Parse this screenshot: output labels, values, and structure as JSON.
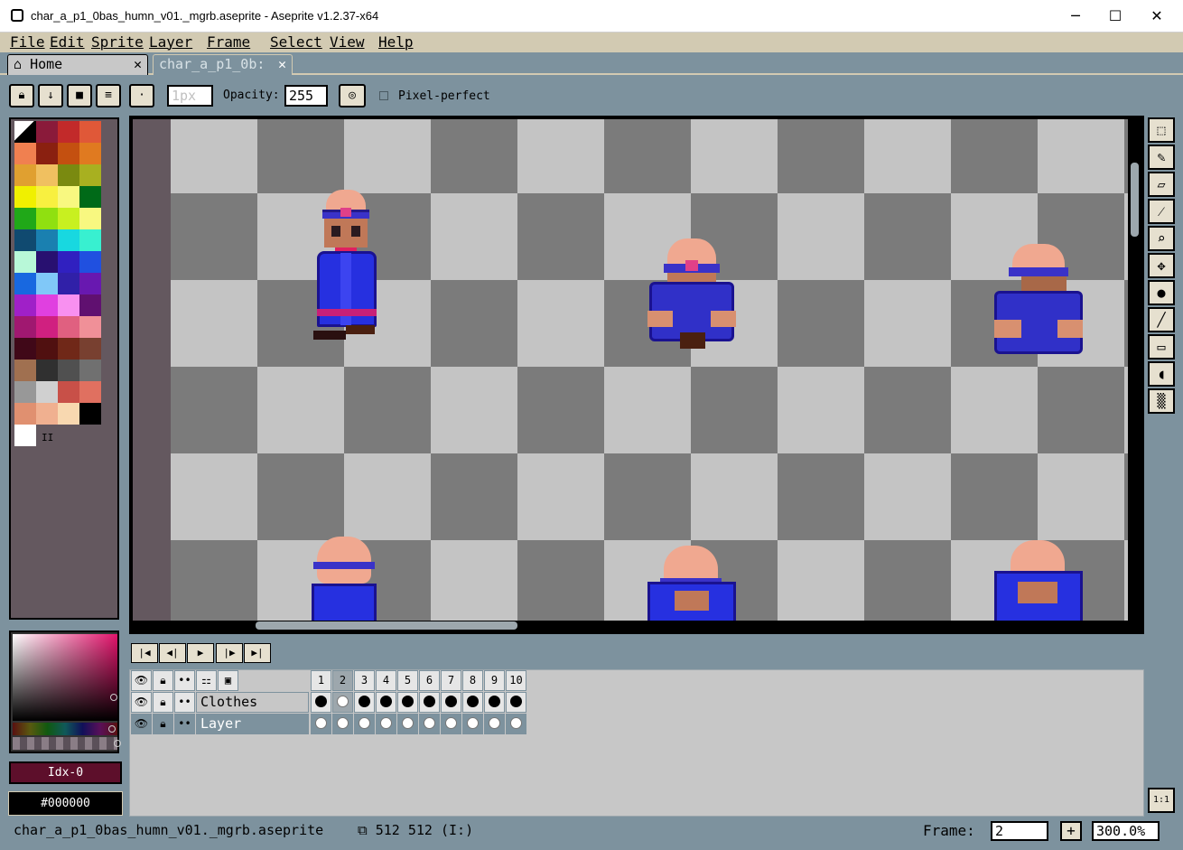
{
  "window": {
    "title": "char_a_p1_0bas_humn_v01._mgrb.aseprite - Aseprite v1.2.37-x64",
    "minimize": "─",
    "maximize": "☐",
    "close": "✕"
  },
  "menu": [
    "File",
    "Edit",
    "Sprite",
    "Layer",
    "Frame",
    "Select",
    "View",
    "Help"
  ],
  "tabs": [
    {
      "label": "Home",
      "icon": "home-icon",
      "close": "✕"
    },
    {
      "label": "char_a_p1_0b:",
      "close": "✕"
    }
  ],
  "context_bar": {
    "brush_size_placeholder": "1px",
    "opacity_label": "Opacity:",
    "opacity_value": "255",
    "pixel_perfect_label": "Pixel-perfect"
  },
  "palette": {
    "colors": [
      "#000000",
      "#8a1a3a",
      "#c22a2a",
      "#e05838",
      "#f08050",
      "#8a2010",
      "#c45010",
      "#e07a20",
      "#e0a030",
      "#f0c060",
      "#7a8a10",
      "#a8b020",
      "#f0f000",
      "#f8f040",
      "#f8f880",
      "#006a18",
      "#20a818",
      "#90e010",
      "#c8f020",
      "#f8f880",
      "#104a70",
      "#1a80b0",
      "#18d8e0",
      "#38f0d0",
      "#b8f8d8",
      "#281070",
      "#3020c0",
      "#2050e0",
      "#1868e0",
      "#80c8f8",
      "#3020a8",
      "#6818b0",
      "#a020c8",
      "#e040e0",
      "#f890f0",
      "#601070",
      "#a01870",
      "#d02080",
      "#e06080",
      "#f09098",
      "#400818",
      "#501010",
      "#702818",
      "#784030",
      "#a07050",
      "#303030",
      "#505050",
      "#707070",
      "#989898",
      "#d0d0d0",
      "#c85048",
      "#e07060",
      "#e09070",
      "#f0b090",
      "#f8d8b0",
      "#000000",
      "#ffffff"
    ],
    "mini_label": "II"
  },
  "color_boxes": {
    "foreground": "Idx-0",
    "background": "#000000"
  },
  "timeline": {
    "frames": [
      "1",
      "2",
      "3",
      "4",
      "5",
      "6",
      "7",
      "8",
      "9",
      "10"
    ],
    "active_frame_index": 1,
    "layers": [
      {
        "name": "Clothes",
        "cel_style": "filled"
      },
      {
        "name": "Layer",
        "cel_style": "empty"
      }
    ]
  },
  "status": {
    "filename": "char_a_p1_0bas_humn_v01._mgrb.aseprite",
    "dimensions": "512 512",
    "extra": "(I:)",
    "frame_label": "Frame:",
    "frame_value": "2",
    "zoom": "300.0%"
  },
  "tools": [
    "marquee-icon",
    "pencil-icon",
    "eraser-icon",
    "eyedropper-icon",
    "zoom-icon",
    "move-icon",
    "paint-bucket-icon",
    "line-icon",
    "rectangle-icon",
    "contour-icon",
    "blur-icon"
  ],
  "ratio_button": "1:1",
  "colors": {
    "menu_bg": "#d2cab2",
    "workspace_bg": "#7d929e",
    "palette_panel_bg": "#64585f",
    "checker_light": "#c4c4c4",
    "checker_dark": "#7b7b7b",
    "foreground_color": "#5d0f2b",
    "background_color": "#000000"
  }
}
